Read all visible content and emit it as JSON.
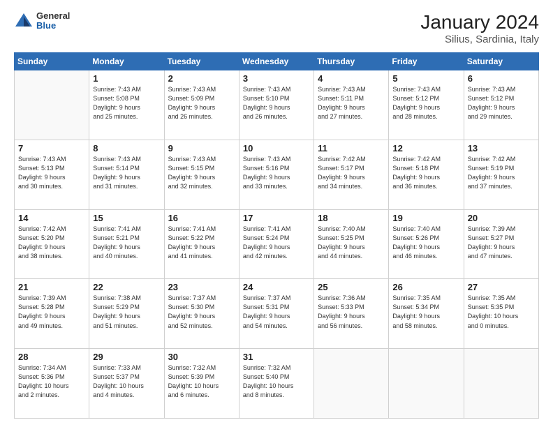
{
  "header": {
    "logo_general": "General",
    "logo_blue": "Blue",
    "title": "January 2024",
    "subtitle": "Silius, Sardinia, Italy"
  },
  "calendar": {
    "weekdays": [
      "Sunday",
      "Monday",
      "Tuesday",
      "Wednesday",
      "Thursday",
      "Friday",
      "Saturday"
    ],
    "weeks": [
      [
        {
          "day": "",
          "info": ""
        },
        {
          "day": "1",
          "info": "Sunrise: 7:43 AM\nSunset: 5:08 PM\nDaylight: 9 hours\nand 25 minutes."
        },
        {
          "day": "2",
          "info": "Sunrise: 7:43 AM\nSunset: 5:09 PM\nDaylight: 9 hours\nand 26 minutes."
        },
        {
          "day": "3",
          "info": "Sunrise: 7:43 AM\nSunset: 5:10 PM\nDaylight: 9 hours\nand 26 minutes."
        },
        {
          "day": "4",
          "info": "Sunrise: 7:43 AM\nSunset: 5:11 PM\nDaylight: 9 hours\nand 27 minutes."
        },
        {
          "day": "5",
          "info": "Sunrise: 7:43 AM\nSunset: 5:12 PM\nDaylight: 9 hours\nand 28 minutes."
        },
        {
          "day": "6",
          "info": "Sunrise: 7:43 AM\nSunset: 5:12 PM\nDaylight: 9 hours\nand 29 minutes."
        }
      ],
      [
        {
          "day": "7",
          "info": "Sunrise: 7:43 AM\nSunset: 5:13 PM\nDaylight: 9 hours\nand 30 minutes."
        },
        {
          "day": "8",
          "info": "Sunrise: 7:43 AM\nSunset: 5:14 PM\nDaylight: 9 hours\nand 31 minutes."
        },
        {
          "day": "9",
          "info": "Sunrise: 7:43 AM\nSunset: 5:15 PM\nDaylight: 9 hours\nand 32 minutes."
        },
        {
          "day": "10",
          "info": "Sunrise: 7:43 AM\nSunset: 5:16 PM\nDaylight: 9 hours\nand 33 minutes."
        },
        {
          "day": "11",
          "info": "Sunrise: 7:42 AM\nSunset: 5:17 PM\nDaylight: 9 hours\nand 34 minutes."
        },
        {
          "day": "12",
          "info": "Sunrise: 7:42 AM\nSunset: 5:18 PM\nDaylight: 9 hours\nand 36 minutes."
        },
        {
          "day": "13",
          "info": "Sunrise: 7:42 AM\nSunset: 5:19 PM\nDaylight: 9 hours\nand 37 minutes."
        }
      ],
      [
        {
          "day": "14",
          "info": "Sunrise: 7:42 AM\nSunset: 5:20 PM\nDaylight: 9 hours\nand 38 minutes."
        },
        {
          "day": "15",
          "info": "Sunrise: 7:41 AM\nSunset: 5:21 PM\nDaylight: 9 hours\nand 40 minutes."
        },
        {
          "day": "16",
          "info": "Sunrise: 7:41 AM\nSunset: 5:22 PM\nDaylight: 9 hours\nand 41 minutes."
        },
        {
          "day": "17",
          "info": "Sunrise: 7:41 AM\nSunset: 5:24 PM\nDaylight: 9 hours\nand 42 minutes."
        },
        {
          "day": "18",
          "info": "Sunrise: 7:40 AM\nSunset: 5:25 PM\nDaylight: 9 hours\nand 44 minutes."
        },
        {
          "day": "19",
          "info": "Sunrise: 7:40 AM\nSunset: 5:26 PM\nDaylight: 9 hours\nand 46 minutes."
        },
        {
          "day": "20",
          "info": "Sunrise: 7:39 AM\nSunset: 5:27 PM\nDaylight: 9 hours\nand 47 minutes."
        }
      ],
      [
        {
          "day": "21",
          "info": "Sunrise: 7:39 AM\nSunset: 5:28 PM\nDaylight: 9 hours\nand 49 minutes."
        },
        {
          "day": "22",
          "info": "Sunrise: 7:38 AM\nSunset: 5:29 PM\nDaylight: 9 hours\nand 51 minutes."
        },
        {
          "day": "23",
          "info": "Sunrise: 7:37 AM\nSunset: 5:30 PM\nDaylight: 9 hours\nand 52 minutes."
        },
        {
          "day": "24",
          "info": "Sunrise: 7:37 AM\nSunset: 5:31 PM\nDaylight: 9 hours\nand 54 minutes."
        },
        {
          "day": "25",
          "info": "Sunrise: 7:36 AM\nSunset: 5:33 PM\nDaylight: 9 hours\nand 56 minutes."
        },
        {
          "day": "26",
          "info": "Sunrise: 7:35 AM\nSunset: 5:34 PM\nDaylight: 9 hours\nand 58 minutes."
        },
        {
          "day": "27",
          "info": "Sunrise: 7:35 AM\nSunset: 5:35 PM\nDaylight: 10 hours\nand 0 minutes."
        }
      ],
      [
        {
          "day": "28",
          "info": "Sunrise: 7:34 AM\nSunset: 5:36 PM\nDaylight: 10 hours\nand 2 minutes."
        },
        {
          "day": "29",
          "info": "Sunrise: 7:33 AM\nSunset: 5:37 PM\nDaylight: 10 hours\nand 4 minutes."
        },
        {
          "day": "30",
          "info": "Sunrise: 7:32 AM\nSunset: 5:39 PM\nDaylight: 10 hours\nand 6 minutes."
        },
        {
          "day": "31",
          "info": "Sunrise: 7:32 AM\nSunset: 5:40 PM\nDaylight: 10 hours\nand 8 minutes."
        },
        {
          "day": "",
          "info": ""
        },
        {
          "day": "",
          "info": ""
        },
        {
          "day": "",
          "info": ""
        }
      ]
    ]
  }
}
